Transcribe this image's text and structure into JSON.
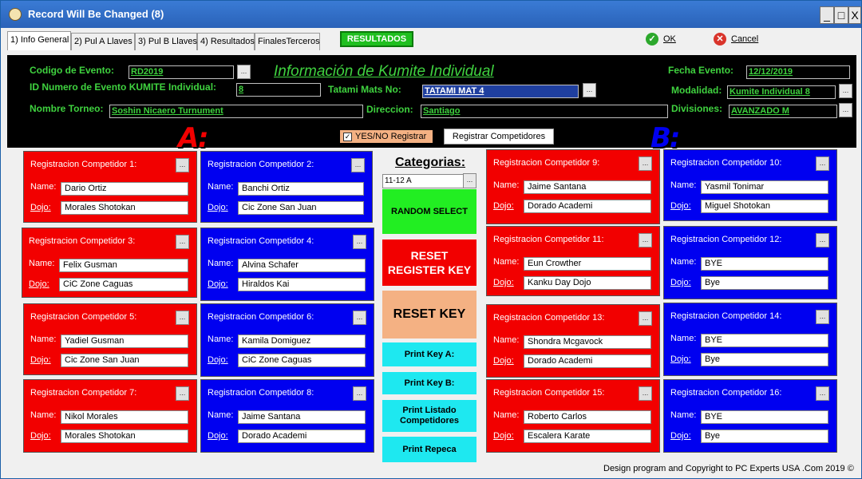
{
  "window": {
    "title": "Record Will Be Changed  (8)",
    "min": "_",
    "max": "□",
    "close": "X"
  },
  "tabs": [
    {
      "label": "1) Info General"
    },
    {
      "label": "2) Pul A Llaves"
    },
    {
      "label": "3) Pul B Llaves"
    },
    {
      "label": "4) Resultados"
    },
    {
      "label": "FinalesTerceros"
    }
  ],
  "toolbar": {
    "resultados": "RESULTADOS",
    "ok": "OK",
    "cancel": "Cancel"
  },
  "event": {
    "codigo_label": "Codigo de Evento:",
    "codigo_value": "RD2019",
    "title": "Información de Kumite Individual",
    "fecha_label": "Fecha Evento:",
    "fecha_value": "12/12/2019",
    "id_label": "ID Numero de Evento KUMITE  Individual:",
    "id_value": "8",
    "tatami_label": "Tatami Mats No:",
    "tatami_value": "TATAMI MAT 4",
    "modalidad_label": "Modalidad:",
    "modalidad_value": "Kumite Individual 8",
    "torneo_label": "Nombre Torneo:",
    "torneo_value": "Soshin Nicaero Turnument",
    "direccion_label": "Direccion:",
    "direccion_value": "Santiago",
    "divisiones_label": "Divisiones:",
    "divisiones_value": "AVANZADO M",
    "dots": "...",
    "yesno_label": "YES/NO Registrar",
    "yesno_checked": "✓",
    "registrar_label": "Registrar Competidores"
  },
  "groups": {
    "a": "A:",
    "b": "B:"
  },
  "competitors": [
    {
      "title": "Registracion Competidor 1:",
      "name_label": "Name:",
      "dojo_label": "Dojo:",
      "name": "Dario Ortiz",
      "dojo": "Morales Shotokan"
    },
    {
      "title": "Registracion Competidor 2:",
      "name_label": "Name:",
      "dojo_label": "Dojo:",
      "name": "Banchi Ortiz",
      "dojo": "Cic Zone San Juan"
    },
    {
      "title": "Registracion Competidor 3:",
      "name_label": "Name:",
      "dojo_label": "Dojo:",
      "name": "Felix Gusman",
      "dojo": "CiC Zone Caguas"
    },
    {
      "title": "Registracion Competidor 4:",
      "name_label": "Name:",
      "dojo_label": "Dojo:",
      "name": "Alvina Schafer",
      "dojo": "Hiraldos Kai"
    },
    {
      "title": "Registracion Competidor 5:",
      "name_label": "Name:",
      "dojo_label": "Dojo:",
      "name": "Yadiel Gusman",
      "dojo": "Cic Zone San Juan"
    },
    {
      "title": "Registracion Competidor 6:",
      "name_label": "Name:",
      "dojo_label": "Dojo:",
      "name": "Kamila Domiguez",
      "dojo": "CiC Zone Caguas"
    },
    {
      "title": "Registracion Competidor 7:",
      "name_label": "Name:",
      "dojo_label": "Dojo:",
      "name": "Nikol Morales",
      "dojo": "Morales Shotokan"
    },
    {
      "title": "Registracion Competidor 8:",
      "name_label": "Name:",
      "dojo_label": "Dojo:",
      "name": "Jaime Santana",
      "dojo": "Dorado Academi"
    },
    {
      "title": "Registracion Competidor 9:",
      "name_label": "Name:",
      "dojo_label": "Dojo:",
      "name": "Jaime Santana",
      "dojo": "Dorado Academi"
    },
    {
      "title": "Registracion Competidor 10:",
      "name_label": "Name:",
      "dojo_label": "Dojo:",
      "name": "Yasmil Tonimar",
      "dojo": "Miguel Shotokan"
    },
    {
      "title": "Registracion Competidor 11:",
      "name_label": "Name:",
      "dojo_label": "Dojo:",
      "name": "Eun Crowther",
      "dojo": "Kanku Day Dojo"
    },
    {
      "title": "Registracion Competidor 12:",
      "name_label": "Name:",
      "dojo_label": "Dojo:",
      "name": "BYE",
      "dojo": "Bye"
    },
    {
      "title": "Registracion Competidor 13:",
      "name_label": "Name:",
      "dojo_label": "Dojo:",
      "name": "Shondra Mcgavock",
      "dojo": "Dorado Academi"
    },
    {
      "title": "Registracion Competidor 14:",
      "name_label": "Name:",
      "dojo_label": "Dojo:",
      "name": "BYE",
      "dojo": "Bye"
    },
    {
      "title": "Registracion Competidor 15:",
      "name_label": "Name:",
      "dojo_label": "Dojo:",
      "name": "Roberto Carlos",
      "dojo": "Escalera Karate"
    },
    {
      "title": "Registracion Competidor 16:",
      "name_label": "Name:",
      "dojo_label": "Dojo:",
      "name": "BYE",
      "dojo": "Bye"
    }
  ],
  "center": {
    "categorias_label": "Categorias:",
    "categoria_value": "11-12 A",
    "random": "RANDOM SELECT",
    "reset_register_1": "RESET",
    "reset_register_2": "REGISTER KEY",
    "reset_key": "RESET KEY",
    "print_a": "Print Key A:",
    "print_b": "Print Key B:",
    "print_listado_1": "Print Listado",
    "print_listado_2": "Competidores",
    "print_repeca": "Print Repeca"
  },
  "footer": "Design program and Copyright to PC Experts USA .Com 2019 ©",
  "colors": {
    "red": "#f20000",
    "blue": "#0000f0",
    "green_text": "#3fd23f",
    "cyan": "#1ee8f0",
    "orange": "#f4b183",
    "random_green": "#22ee22"
  }
}
